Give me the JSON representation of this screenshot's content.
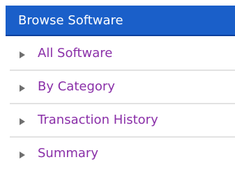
{
  "panel": {
    "title": "Browse Software",
    "header_color": "#1a5fc9",
    "link_color": "#8a2fa8",
    "items": [
      {
        "label": "All Software",
        "icon": "arrow-right-icon"
      },
      {
        "label": "By Category",
        "icon": "arrow-right-icon"
      },
      {
        "label": "Transaction History",
        "icon": "arrow-right-icon"
      },
      {
        "label": "Summary",
        "icon": "arrow-right-icon"
      }
    ]
  }
}
